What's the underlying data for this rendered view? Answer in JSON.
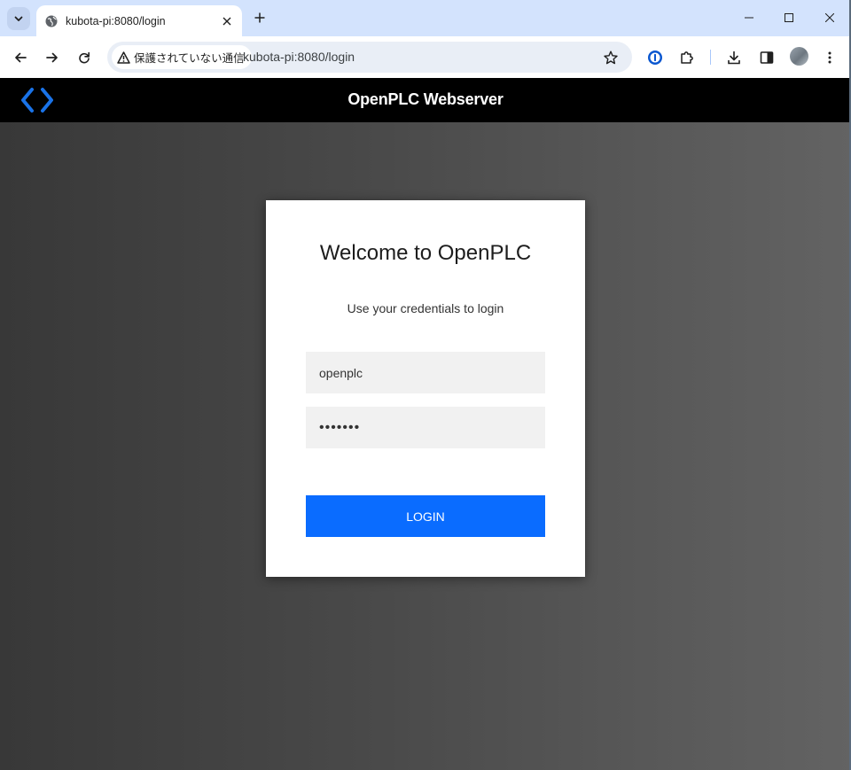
{
  "browser": {
    "tab": {
      "title": "kubota-pi:8080/login"
    },
    "omnibox": {
      "security_label": "保護されていない通信",
      "url": "kubota-pi:8080/login"
    }
  },
  "app": {
    "header_title": "OpenPLC Webserver",
    "logo_color": "#1a73e8"
  },
  "login": {
    "heading": "Welcome to OpenPLC",
    "subheading": "Use your credentials to login",
    "username_value": "openplc",
    "password_value": "openplc",
    "button_label": "LOGIN",
    "button_color": "#0a6cff"
  }
}
